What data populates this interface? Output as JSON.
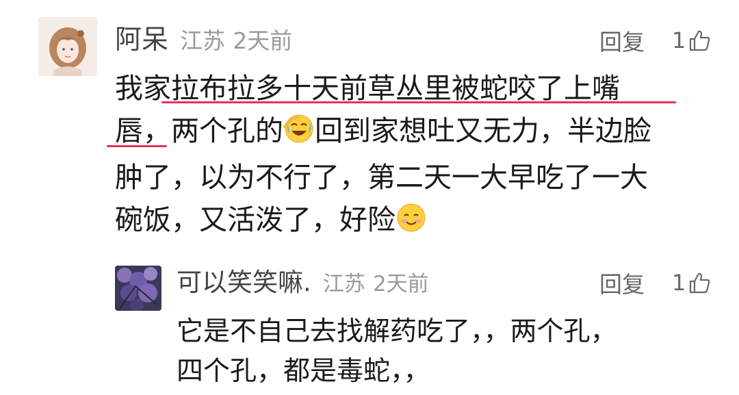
{
  "comments": [
    {
      "username": "阿呆",
      "location": "江苏",
      "time": "2天前",
      "reply_label": "回复",
      "like_count": "1",
      "lines": [
        "我家拉布拉多十天前草丛里被蛇咬了上嘴",
        "唇，两个孔的",
        "回到家想吐又无力，半边脸",
        "肿了，以为不行了，第二天一大早吃了一大",
        "碗饭，又活泼了，好险"
      ]
    },
    {
      "username": "可以笑笑嘛.",
      "location": "江苏",
      "time": "2天前",
      "reply_label": "回复",
      "like_count": "1",
      "lines": [
        "它是不自己去找解药吃了，，两个孔，",
        "四个孔，都是毒蛇，，"
      ]
    }
  ],
  "icons": {
    "like": "thumbs-up-icon",
    "emoji_1": "face-crying-laughing-emoji",
    "emoji_2": "smiling-blushing-emoji"
  },
  "colors": {
    "underline": "#e8305a",
    "meta_gray": "#9a9a9a"
  }
}
